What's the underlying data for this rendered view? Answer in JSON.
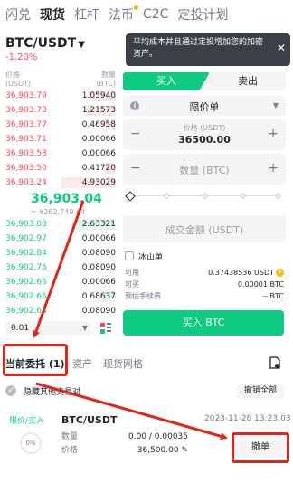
{
  "top_tabs": [
    {
      "label": "闪兑",
      "active": false
    },
    {
      "label": "现货",
      "active": true
    },
    {
      "label": "杠杆",
      "active": false
    },
    {
      "label": "法币",
      "active": false,
      "dot": true
    },
    {
      "label": "C2C",
      "active": false
    },
    {
      "label": "定投计划",
      "active": false
    }
  ],
  "pair": {
    "name": "BTC/USDT",
    "change": "-1.20%"
  },
  "tooltip": {
    "text": "平均成本并且通过定投增加您的加密资产。"
  },
  "order_book": {
    "price_header": "价格",
    "price_unit": "(USDT)",
    "qty_header": "数量",
    "qty_unit": "(BTC)",
    "asks": [
      {
        "price": "36,903.79",
        "qty": "1.05940"
      },
      {
        "price": "36,903.78",
        "qty": "1.21573"
      },
      {
        "price": "36,903.77",
        "qty": "0.46958"
      },
      {
        "price": "36,903.71",
        "qty": "0.00066"
      },
      {
        "price": "36,903.58",
        "qty": "0.00066"
      },
      {
        "price": "36,903.50",
        "qty": "0.41720"
      },
      {
        "price": "36,903.24",
        "qty": "4.93029"
      }
    ],
    "mid_price": "36,903.04",
    "mid_fiat": "≈ ¥262,749.64",
    "bids": [
      {
        "price": "36,903.03",
        "qty": "2.63321"
      },
      {
        "price": "36,902.97",
        "qty": "0.00066"
      },
      {
        "price": "36,902.84",
        "qty": "0.08090"
      },
      {
        "price": "36,902.76",
        "qty": "0.08090"
      },
      {
        "price": "36,902.66",
        "qty": "0.00066"
      },
      {
        "price": "36,902.66",
        "qty": "0.68637"
      },
      {
        "price": "36,902.64",
        "qty": "0.08090"
      }
    ],
    "precision": "0.01"
  },
  "trade_panel": {
    "buy_tab": "买入",
    "sell_tab": "卖出",
    "order_type": "限价单",
    "price_label": "价格 (USDT)",
    "price_value": "36500.00",
    "amount_placeholder": "数量 (BTC)",
    "total_placeholder": "成交金额 (USDT)",
    "iceberg_label": "冰山单",
    "available_label": "可用",
    "available_value": "0.37438536 USDT",
    "can_buy_label": "可买",
    "can_buy_value": "0.00001 BTC",
    "fee_label": "预估手续费",
    "fee_value": "-- BTC",
    "buy_button": "买入 BTC"
  },
  "bottom_tabs": [
    {
      "label": "当前委托 (1)",
      "active": true
    },
    {
      "label": "资产",
      "active": false
    },
    {
      "label": "现货网格",
      "active": false
    }
  ],
  "hide_other_pairs": "隐藏其他交易对",
  "cancel_all": "撤销全部",
  "open_order": {
    "type": "限价/买入",
    "pair": "BTC/USDT",
    "time": "2023-11-28 13:23:03",
    "progress": "0%",
    "qty_label": "数量",
    "qty_value": "0.00 / 0.00035",
    "price_label": "价格",
    "price_value": "36,500.00",
    "cancel_button": "撤单"
  },
  "colors": {
    "buy": "#0ecb81",
    "sell": "#f6465d",
    "accent": "#f0b90b",
    "annotation": "#e0251b"
  }
}
